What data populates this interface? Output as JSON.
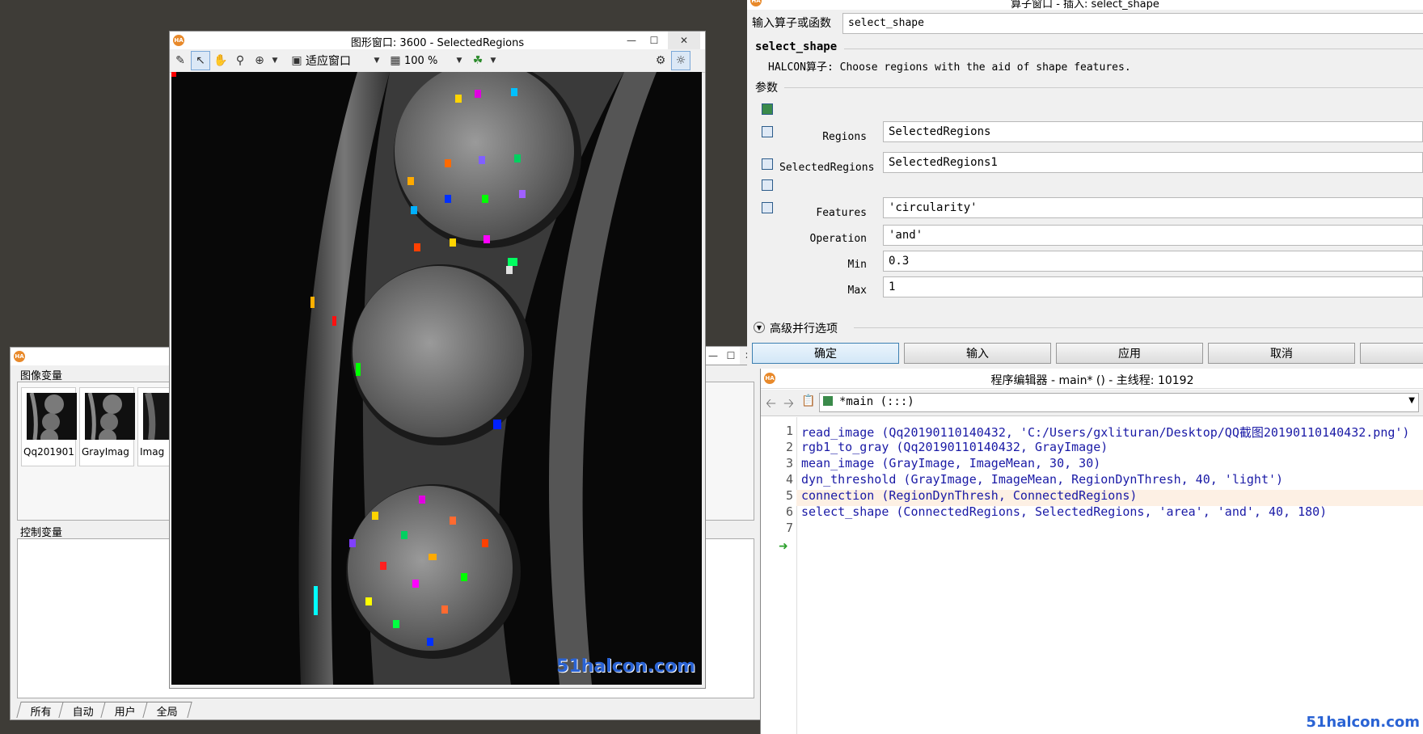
{
  "variable_window": {
    "image_vars_label": "图像变量",
    "control_vars_label": "控制变量",
    "thumbnails": [
      {
        "label": "Qq201901"
      },
      {
        "label": "GrayImag"
      },
      {
        "label": "Imag"
      }
    ],
    "tabs": [
      "所有",
      "自动",
      "用户",
      "全局"
    ]
  },
  "graphics_window": {
    "title": "图形窗口: 3600 - SelectedRegions",
    "fit_label": "适应窗口",
    "zoom_label": "100 %",
    "watermark": "51halcon.com"
  },
  "operator_window": {
    "title": "算子窗口 - 插入:  select_shape",
    "input_label": "输入算子或函数",
    "input_value": "select_shape",
    "operator_name": "select_shape",
    "operator_desc": "HALCON算子: Choose regions with the aid of shape features.",
    "params_label": "参数",
    "params": [
      {
        "label": "Regions",
        "value": "SelectedRegions"
      },
      {
        "label": "SelectedRegions",
        "value": "SelectedRegions1"
      },
      {
        "label": "Features",
        "value": "'circularity'"
      },
      {
        "label": "Operation",
        "value": "'and'"
      },
      {
        "label": "Min",
        "value": "0.3"
      },
      {
        "label": "Max",
        "value": "1"
      }
    ],
    "advanced_label": "高级并行选项",
    "buttons": {
      "ok": "确定",
      "input": "输入",
      "apply": "应用",
      "cancel": "取消"
    }
  },
  "program_editor": {
    "title": "程序编辑器 - main* () - 主线程: 10192",
    "procedure": "*main (:::)",
    "lines": [
      "read_image (Qq20190110140432, 'C:/Users/gxlituran/Desktop/QQ截图20190110140432.png')",
      "rgb1_to_gray (Qq20190110140432, GrayImage)",
      "mean_image (GrayImage, ImageMean, 30, 30)",
      "dyn_threshold (GrayImage, ImageMean, RegionDynThresh, 40, 'light')",
      "connection (RegionDynThresh, ConnectedRegions)",
      "select_shape (ConnectedRegions, SelectedRegions, 'area', 'and', 40, 180)",
      ""
    ],
    "line_numbers": [
      "1",
      "2",
      "3",
      "4",
      "5",
      "6",
      "7"
    ]
  },
  "corner_watermark": "51halcon.com",
  "colors": {
    "accent": "#3c7fb1",
    "code": "#1a1aa6",
    "halcon_orange": "#e8892a"
  }
}
